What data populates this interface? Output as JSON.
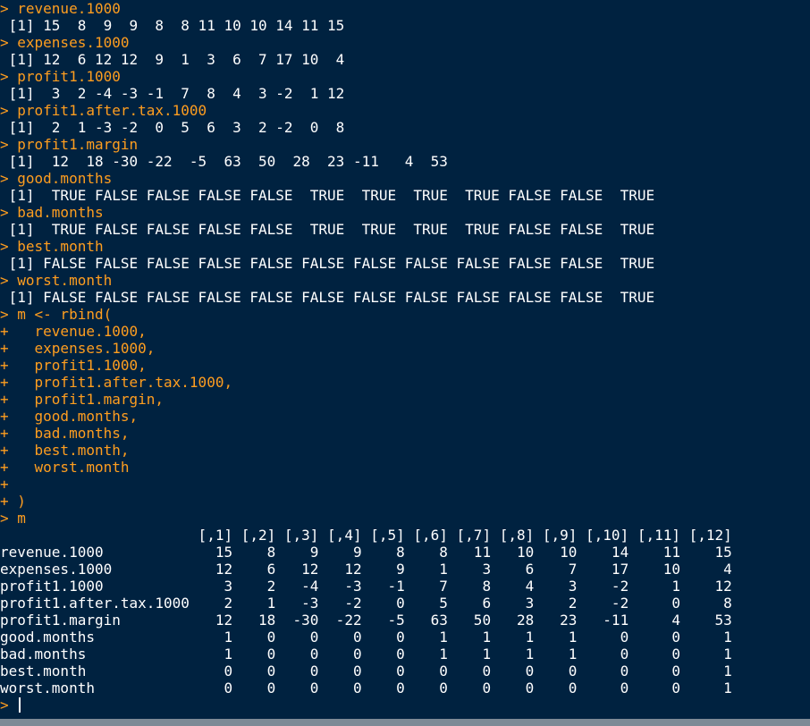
{
  "theme": {
    "background": "#002240",
    "command_color": "#ff9e1f",
    "output_color": "#ffffff"
  },
  "console": {
    "lines": [
      {
        "prompt": "> ",
        "text": "revenue.1000",
        "kind": "cmd"
      },
      {
        "prompt": "",
        "text": " [1] 15  8  9  9  8  8 11 10 10 14 11 15",
        "kind": "out"
      },
      {
        "prompt": "> ",
        "text": "expenses.1000",
        "kind": "cmd"
      },
      {
        "prompt": "",
        "text": " [1] 12  6 12 12  9  1  3  6  7 17 10  4",
        "kind": "out"
      },
      {
        "prompt": "> ",
        "text": "profit1.1000",
        "kind": "cmd"
      },
      {
        "prompt": "",
        "text": " [1]  3  2 -4 -3 -1  7  8  4  3 -2  1 12",
        "kind": "out"
      },
      {
        "prompt": "> ",
        "text": "profit1.after.tax.1000",
        "kind": "cmd"
      },
      {
        "prompt": "",
        "text": " [1]  2  1 -3 -2  0  5  6  3  2 -2  0  8",
        "kind": "out"
      },
      {
        "prompt": "> ",
        "text": "profit1.margin",
        "kind": "cmd"
      },
      {
        "prompt": "",
        "text": " [1]  12  18 -30 -22  -5  63  50  28  23 -11   4  53",
        "kind": "out"
      },
      {
        "prompt": "> ",
        "text": "good.months",
        "kind": "cmd"
      },
      {
        "prompt": "",
        "text": " [1]  TRUE FALSE FALSE FALSE FALSE  TRUE  TRUE  TRUE  TRUE FALSE FALSE  TRUE",
        "kind": "out"
      },
      {
        "prompt": "> ",
        "text": "bad.months",
        "kind": "cmd"
      },
      {
        "prompt": "",
        "text": " [1]  TRUE FALSE FALSE FALSE FALSE  TRUE  TRUE  TRUE  TRUE FALSE FALSE  TRUE",
        "kind": "out"
      },
      {
        "prompt": "> ",
        "text": "best.month",
        "kind": "cmd"
      },
      {
        "prompt": "",
        "text": " [1] FALSE FALSE FALSE FALSE FALSE FALSE FALSE FALSE FALSE FALSE FALSE  TRUE",
        "kind": "out"
      },
      {
        "prompt": "> ",
        "text": "worst.month",
        "kind": "cmd"
      },
      {
        "prompt": "",
        "text": " [1] FALSE FALSE FALSE FALSE FALSE FALSE FALSE FALSE FALSE FALSE FALSE  TRUE",
        "kind": "out"
      },
      {
        "prompt": "> ",
        "text": "m <- rbind(",
        "kind": "cmd"
      },
      {
        "prompt": "+ ",
        "text": "  revenue.1000,",
        "kind": "cmd"
      },
      {
        "prompt": "+ ",
        "text": "  expenses.1000,",
        "kind": "cmd"
      },
      {
        "prompt": "+ ",
        "text": "  profit1.1000,",
        "kind": "cmd"
      },
      {
        "prompt": "+ ",
        "text": "  profit1.after.tax.1000,",
        "kind": "cmd"
      },
      {
        "prompt": "+ ",
        "text": "  profit1.margin,",
        "kind": "cmd"
      },
      {
        "prompt": "+ ",
        "text": "  good.months,",
        "kind": "cmd"
      },
      {
        "prompt": "+ ",
        "text": "  bad.months,",
        "kind": "cmd"
      },
      {
        "prompt": "+ ",
        "text": "  best.month,",
        "kind": "cmd"
      },
      {
        "prompt": "+ ",
        "text": "  worst.month",
        "kind": "cmd"
      },
      {
        "prompt": "+ ",
        "text": "",
        "kind": "cmd"
      },
      {
        "prompt": "+ ",
        "text": ")",
        "kind": "cmd"
      },
      {
        "prompt": "> ",
        "text": "m",
        "kind": "cmd"
      },
      {
        "prompt": "",
        "text": "                       [,1] [,2] [,3] [,4] [,5] [,6] [,7] [,8] [,9] [,10] [,11] [,12]",
        "kind": "out"
      },
      {
        "prompt": "",
        "text": "revenue.1000             15    8    9    9    8    8   11   10   10    14    11    15",
        "kind": "out"
      },
      {
        "prompt": "",
        "text": "expenses.1000            12    6   12   12    9    1    3    6    7    17    10     4",
        "kind": "out"
      },
      {
        "prompt": "",
        "text": "profit1.1000              3    2   -4   -3   -1    7    8    4    3    -2     1    12",
        "kind": "out"
      },
      {
        "prompt": "",
        "text": "profit1.after.tax.1000    2    1   -3   -2    0    5    6    3    2    -2     0     8",
        "kind": "out"
      },
      {
        "prompt": "",
        "text": "profit1.margin           12   18  -30  -22   -5   63   50   28   23   -11     4    53",
        "kind": "out"
      },
      {
        "prompt": "",
        "text": "good.months               1    0    0    0    0    1    1    1    1     0     0     1",
        "kind": "out"
      },
      {
        "prompt": "",
        "text": "bad.months                1    0    0    0    0    1    1    1    1     0     0     1",
        "kind": "out"
      },
      {
        "prompt": "",
        "text": "best.month                0    0    0    0    0    0    0    0    0     0     0     1",
        "kind": "out"
      },
      {
        "prompt": "",
        "text": "worst.month               0    0    0    0    0    0    0    0    0     0     0     1",
        "kind": "out"
      }
    ],
    "input_prompt": "> ",
    "input_value": ""
  }
}
